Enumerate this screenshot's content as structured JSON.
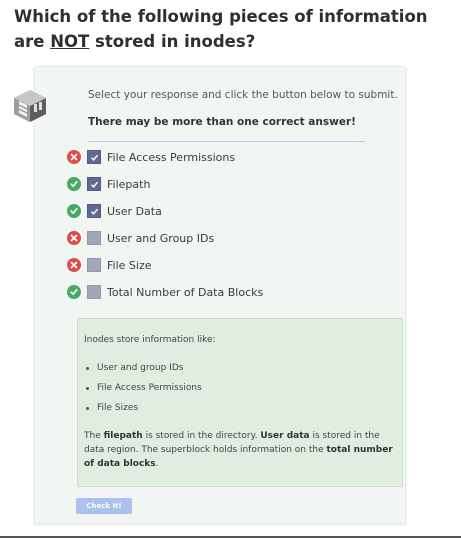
{
  "question": {
    "prefix": "Which of the following pieces of information are ",
    "negation": "NOT",
    "suffix": " stored in inodes?"
  },
  "card": {
    "icon": "server-rack-icon",
    "instructions": "Select your response and click the button below to submit.",
    "multi_note": "There may be more than one correct answer!"
  },
  "options": [
    {
      "label": "File Access Permissions",
      "checked": true,
      "result": "incorrect",
      "result_icon": "x-icon"
    },
    {
      "label": "Filepath",
      "checked": true,
      "result": "correct",
      "result_icon": "check-icon"
    },
    {
      "label": "User Data",
      "checked": true,
      "result": "correct",
      "result_icon": "check-icon"
    },
    {
      "label": "User and Group IDs",
      "checked": false,
      "result": "incorrect",
      "result_icon": "x-icon"
    },
    {
      "label": "File Size",
      "checked": false,
      "result": "incorrect",
      "result_icon": "x-icon"
    },
    {
      "label": "Total Number of Data Blocks",
      "checked": false,
      "result": "correct",
      "result_icon": "check-icon"
    }
  ],
  "explanation": {
    "intro": "Inodes store information like:",
    "items": [
      "User and group IDs",
      "File Access Permissions",
      "File Sizes"
    ],
    "text_1": "The ",
    "bold_1": "filepath",
    "text_2": " is stored in the directory. ",
    "bold_2": "User data",
    "text_3": " is stored in the data region. The superblock holds information on the ",
    "bold_3": "total number of data blocks",
    "text_4": "."
  },
  "submit_label": "Check It!",
  "colors": {
    "correct": "#4aa866",
    "incorrect": "#dc4e4e",
    "checkbox_checked": "#616893",
    "checkbox_unchecked": "#a3a6b8",
    "button": "#a9c2ee",
    "card_bg": "#f2f6f2",
    "explanation_bg": "#e1ede1"
  }
}
